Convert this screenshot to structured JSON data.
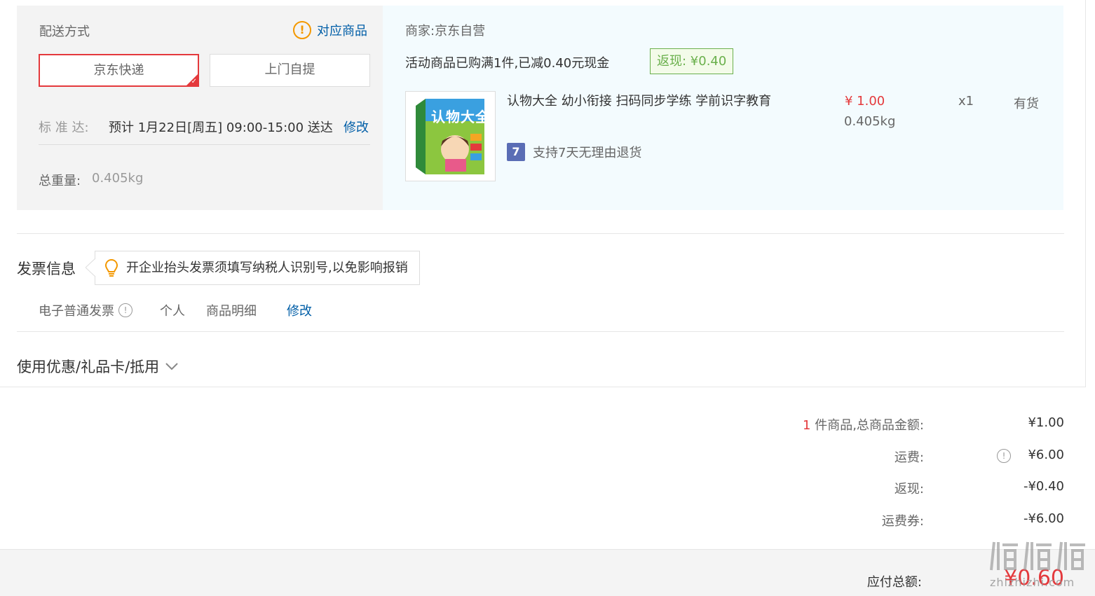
{
  "shipping": {
    "title": "配送方式",
    "related_goods_link": "对应商品",
    "options": [
      "京东快递",
      "上门自提"
    ],
    "selected": "京东快递",
    "standard_label": "标 准 达:",
    "standard_value": "预计 1月22日[周五] 09:00-15:00 送达",
    "modify": "修改",
    "weight_label": "总重量:",
    "weight_value": "0.405kg"
  },
  "goods": {
    "merchant": "商家:京东自营",
    "promo_text": "活动商品已购满1件,已减0.40元现金",
    "cashback_tag": "返现: ¥0.40",
    "item": {
      "cover_title": "认物大全",
      "name": "认物大全 幼小衔接 扫码同步学练 学前识字教育",
      "price": "¥ 1.00",
      "weight": "0.405kg",
      "qty": "x1",
      "stock": "有货",
      "return_badge": "7",
      "return_policy": "支持7天无理由退货"
    }
  },
  "invoice": {
    "title": "发票信息",
    "tip": "开企业抬头发票须填写纳税人识别号,以免影响报销",
    "type": "电子普通发票",
    "holder": "个人",
    "content": "商品明细",
    "modify": "修改"
  },
  "coupon": {
    "label": "使用优惠/礼品卡/抵用"
  },
  "summary": {
    "count": "1",
    "count_label": " 件商品,总商品金额:",
    "goods_total": "¥1.00",
    "freight_label": "运费:",
    "freight": "¥6.00",
    "cashback_label": "返现:",
    "cashback": "-¥0.40",
    "freight_coupon_label": "运费券:",
    "freight_coupon": "-¥6.00",
    "payable_label": "应付总额:",
    "payable": "¥0.60"
  },
  "watermark": {
    "text": "zhizhizhi.com"
  },
  "colors": {
    "accent_red": "#e4393c",
    "link_blue": "#005ea7",
    "cashback_green": "#6ab04c",
    "warning_orange": "#f39800"
  }
}
